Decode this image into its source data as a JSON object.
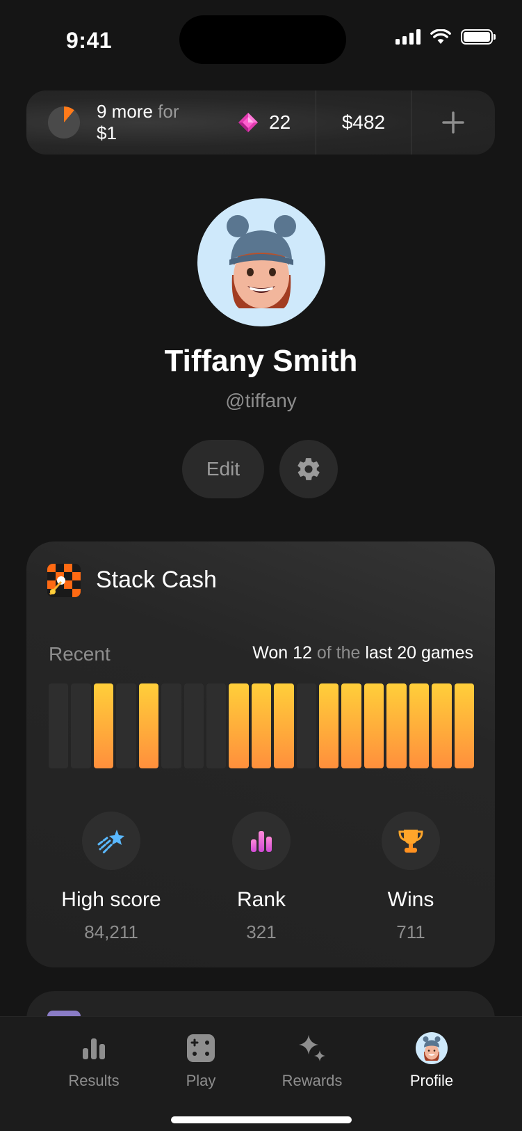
{
  "status_bar": {
    "time": "9:41"
  },
  "top_bar": {
    "progress_prefix": "9 more ",
    "progress_for": "for",
    "progress_reward": " $1",
    "gems": "22",
    "cash": "$482",
    "progress_fraction": 0.11
  },
  "profile": {
    "name": "Tiffany Smith",
    "handle": "@tiffany",
    "edit_label": "Edit"
  },
  "game_card": {
    "title": "Stack Cash",
    "recent_label": "Recent",
    "summary": {
      "won": "Won 12",
      "of_the": " of the ",
      "last": "last 20 games"
    },
    "recent_results": [
      0,
      0,
      1,
      0,
      1,
      0,
      0,
      0,
      1,
      1,
      1,
      0,
      1,
      1,
      1,
      1,
      1,
      1,
      1
    ],
    "stats": [
      {
        "icon": "shooting-star-icon",
        "label": "High score",
        "value": "84,211"
      },
      {
        "icon": "bar-chart-icon",
        "label": "Rank",
        "value": "321"
      },
      {
        "icon": "trophy-icon",
        "label": "Wins",
        "value": "711"
      }
    ]
  },
  "tab_bar": {
    "tabs": [
      {
        "icon": "results-icon",
        "label": "Results",
        "active": false
      },
      {
        "icon": "play-icon",
        "label": "Play",
        "active": false
      },
      {
        "icon": "rewards-icon",
        "label": "Rewards",
        "active": false
      },
      {
        "icon": "avatar-icon",
        "label": "Profile",
        "active": true
      }
    ]
  },
  "colors": {
    "accent_win_top": "#ffcf3a",
    "accent_win_bottom": "#ff8f3c",
    "progress": "#ff7a1a"
  }
}
